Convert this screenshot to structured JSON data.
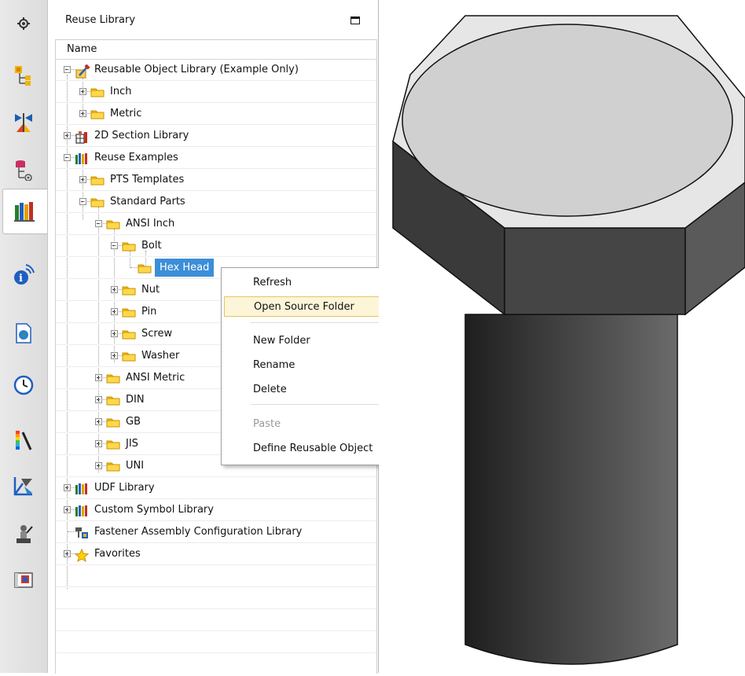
{
  "panel": {
    "title": "Reuse Library"
  },
  "tree": {
    "column_header": "Name",
    "nodes": [
      {
        "label": "Reusable Object Library (Example Only)"
      },
      {
        "label": "Inch"
      },
      {
        "label": "Metric"
      },
      {
        "label": "2D Section Library"
      },
      {
        "label": "Reuse Examples"
      },
      {
        "label": "PTS Templates"
      },
      {
        "label": "Standard Parts"
      },
      {
        "label": "ANSI Inch"
      },
      {
        "label": "Bolt"
      },
      {
        "label": "Hex Head"
      },
      {
        "label": "Nut"
      },
      {
        "label": "Pin"
      },
      {
        "label": "Screw"
      },
      {
        "label": "Washer"
      },
      {
        "label": "ANSI Metric"
      },
      {
        "label": "DIN"
      },
      {
        "label": "GB"
      },
      {
        "label": "JIS"
      },
      {
        "label": "UNI"
      },
      {
        "label": "UDF Library"
      },
      {
        "label": "Custom Symbol Library"
      },
      {
        "label": "Fastener Assembly Configuration Library"
      },
      {
        "label": "Favorites"
      }
    ]
  },
  "context_menu": {
    "items": [
      {
        "label": "Refresh"
      },
      {
        "label": "Open Source Folder"
      },
      {
        "label": "New Folder"
      },
      {
        "label": "Rename"
      },
      {
        "label": "Delete"
      },
      {
        "label": "Paste"
      },
      {
        "label": "Define Reusable Object"
      }
    ]
  },
  "toolbar": {
    "icons": [
      "settings-gear-icon",
      "assembly-navigator-icon",
      "constraint-navigator-icon",
      "part-navigator-icon",
      "reuse-library-icon",
      "hd3d-tools-icon",
      "web-browser-icon",
      "history-icon",
      "visualization-palette-icon",
      "system-scene-icon",
      "roles-icon",
      "process-studio-icon"
    ]
  },
  "colors": {
    "selection": "#3b8ed8",
    "menu_hover": "#fdf5d8",
    "folder": "#f5c400"
  }
}
